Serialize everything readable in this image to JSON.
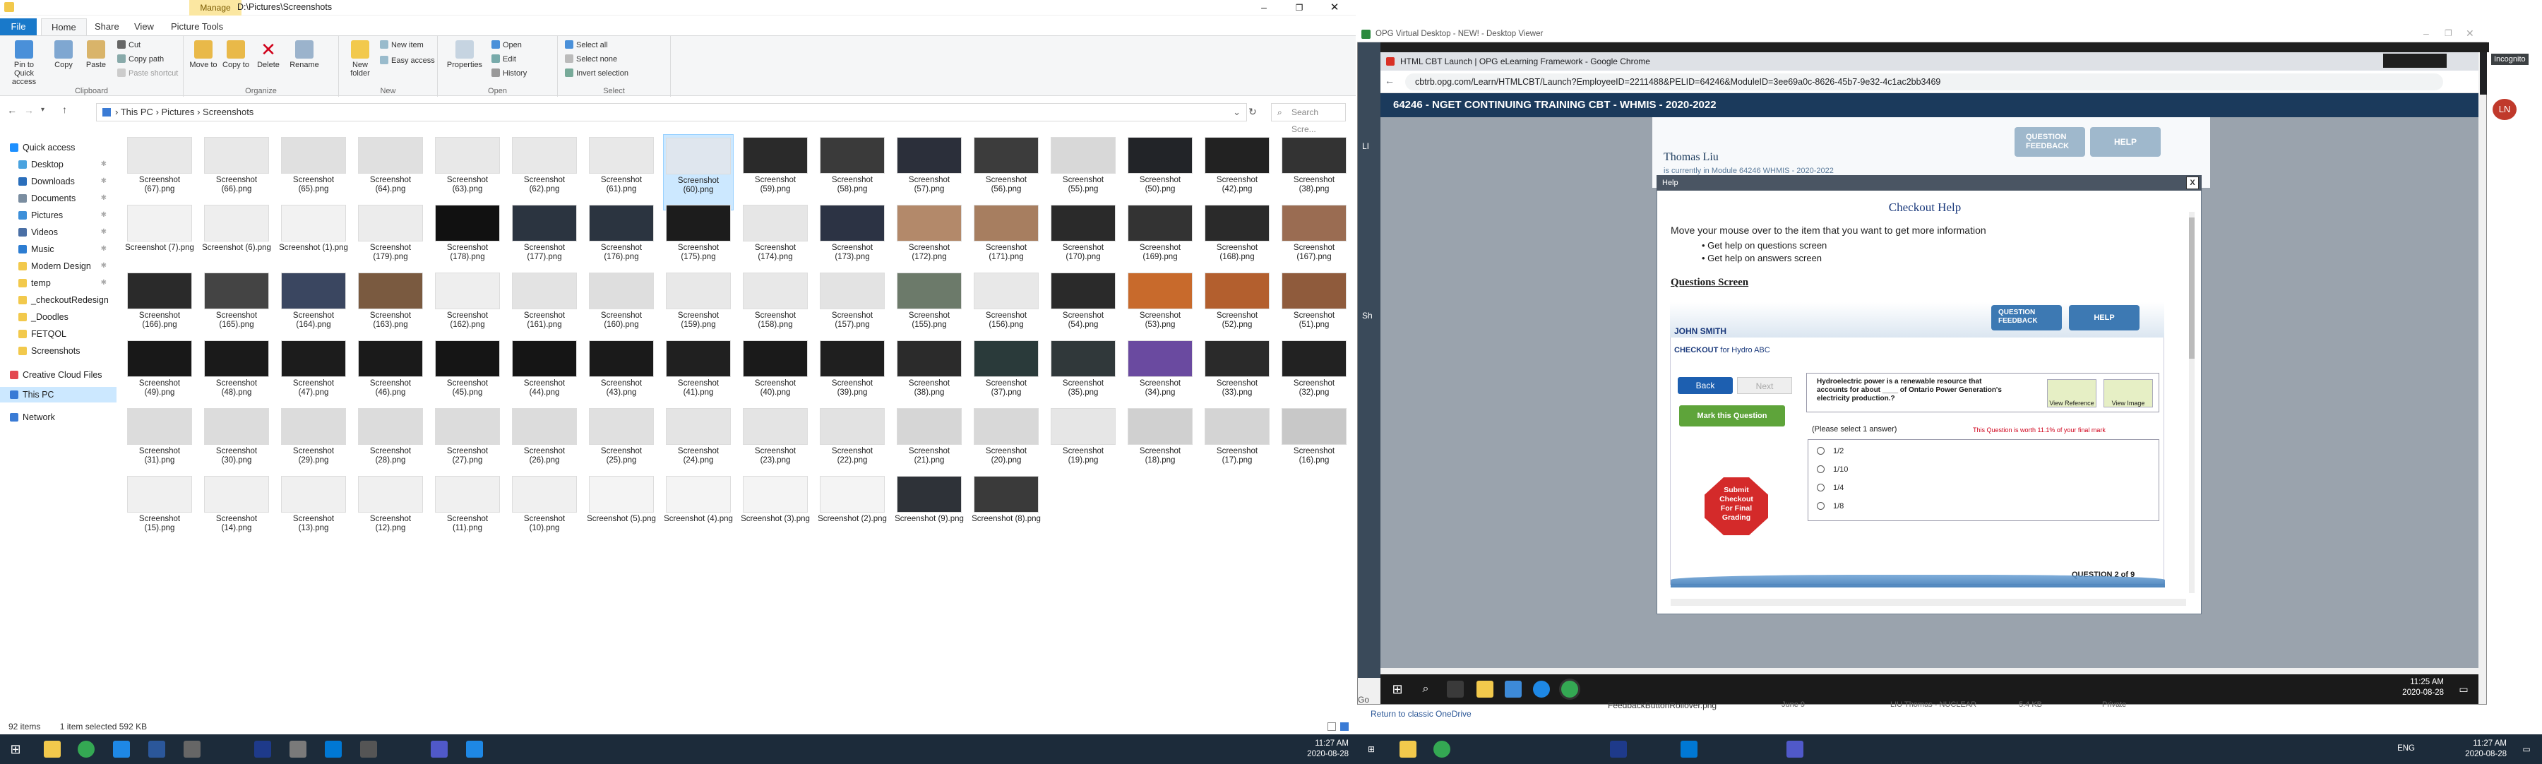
{
  "explorer": {
    "title": "D:\\Pictures\\Screenshots",
    "manage_tab": "Manage",
    "tabs": [
      "File",
      "Home",
      "Share",
      "View",
      "Picture Tools"
    ],
    "groups": {
      "clipboard": "Clipboard",
      "organize": "Organize",
      "new": "New",
      "open": "Open",
      "select": "Select"
    },
    "buttons": {
      "pin": "Pin to Quick access",
      "copy": "Copy",
      "paste": "Paste",
      "cut": "Cut",
      "copy_path": "Copy path",
      "paste_shortcut": "Paste shortcut",
      "move_to": "Move to",
      "copy_to": "Copy to",
      "delete": "Delete",
      "rename": "Rename",
      "new_folder": "New folder",
      "new_item": "New item",
      "easy_access": "Easy access",
      "properties": "Properties",
      "open": "Open",
      "edit": "Edit",
      "history": "History",
      "select_all": "Select all",
      "select_none": "Select none",
      "invert_selection": "Invert selection"
    },
    "breadcrumb": [
      "This PC",
      "Pictures",
      "Screenshots"
    ],
    "search_placeholder": "Search Scre...",
    "nav": [
      {
        "label": "Quick access",
        "icon": "star-icon",
        "color": "#1e90ff",
        "pin": false
      },
      {
        "label": "Desktop",
        "icon": "folder-icon",
        "color": "#4aa3df",
        "pin": true
      },
      {
        "label": "Downloads",
        "icon": "download-icon",
        "color": "#2a6ebb",
        "pin": true
      },
      {
        "label": "Documents",
        "icon": "documents-icon",
        "color": "#7a8da0",
        "pin": true
      },
      {
        "label": "Pictures",
        "icon": "pictures-icon",
        "color": "#3c8fd9",
        "pin": true
      },
      {
        "label": "Videos",
        "icon": "videos-icon",
        "color": "#4a6fa5",
        "pin": true
      },
      {
        "label": "Music",
        "icon": "music-icon",
        "color": "#2d7dd2",
        "pin": true
      },
      {
        "label": "Modern Design",
        "icon": "folder-icon",
        "color": "#f2c94c",
        "pin": true
      },
      {
        "label": "temp",
        "icon": "folder-icon",
        "color": "#f2c94c",
        "pin": true
      },
      {
        "label": "_checkoutRedesign",
        "icon": "folder-icon",
        "color": "#f2c94c",
        "pin": false
      },
      {
        "label": "_Doodles",
        "icon": "folder-icon",
        "color": "#f2c94c",
        "pin": false
      },
      {
        "label": "FETQOL",
        "icon": "folder-icon",
        "color": "#f2c94c",
        "pin": false
      },
      {
        "label": "Screenshots",
        "icon": "folder-icon",
        "color": "#f2c94c",
        "pin": false
      },
      {
        "label": "Creative Cloud Files",
        "icon": "cloud-icon",
        "color": "#e34850",
        "pin": false
      },
      {
        "label": "This PC",
        "icon": "computer-icon",
        "color": "#3a7bd5",
        "pin": false
      },
      {
        "label": "Network",
        "icon": "network-icon",
        "color": "#3a7bd5",
        "pin": false
      }
    ],
    "thumbs": [
      [
        "Screenshot (67).png",
        "Screenshot (66).png",
        "Screenshot (65).png",
        "Screenshot (64).png",
        "Screenshot (63).png",
        "Screenshot (62).png",
        "Screenshot (61).png",
        "Screenshot (60).png",
        "Screenshot (59).png",
        "Screenshot (58).png",
        "Screenshot (57).png",
        "Screenshot (56).png",
        "Screenshot (55).png",
        "Screenshot (50).png",
        "Screenshot (42).png",
        "Screenshot (38).png"
      ],
      [
        "Screenshot (7).png",
        "Screenshot (6).png",
        "Screenshot (1).png",
        "Screenshot (179).png",
        "Screenshot (178).png",
        "Screenshot (177).png",
        "Screenshot (176).png",
        "Screenshot (175).png",
        "Screenshot (174).png",
        "Screenshot (173).png",
        "Screenshot (172).png",
        "Screenshot (171).png",
        "Screenshot (170).png",
        "Screenshot (169).png",
        "Screenshot (168).png",
        "Screenshot (167).png"
      ],
      [
        "Screenshot (166).png",
        "Screenshot (165).png",
        "Screenshot (164).png",
        "Screenshot (163).png",
        "Screenshot (162).png",
        "Screenshot (161).png",
        "Screenshot (160).png",
        "Screenshot (159).png",
        "Screenshot (158).png",
        "Screenshot (157).png",
        "Screenshot (155).png",
        "Screenshot (156).png",
        "Screenshot (54).png",
        "Screenshot (53).png",
        "Screenshot (52).png",
        "Screenshot (51).png"
      ],
      [
        "Screenshot (49).png",
        "Screenshot (48).png",
        "Screenshot (47).png",
        "Screenshot (46).png",
        "Screenshot (45).png",
        "Screenshot (44).png",
        "Screenshot (43).png",
        "Screenshot (41).png",
        "Screenshot (40).png",
        "Screenshot (39).png",
        "Screenshot (38).png",
        "Screenshot (37).png",
        "Screenshot (35).png",
        "Screenshot (34).png",
        "Screenshot (33).png",
        "Screenshot (32).png"
      ],
      [
        "Screenshot (31).png",
        "Screenshot (30).png",
        "Screenshot (29).png",
        "Screenshot (28).png",
        "Screenshot (27).png",
        "Screenshot (26).png",
        "Screenshot (25).png",
        "Screenshot (24).png",
        "Screenshot (23).png",
        "Screenshot (22).png",
        "Screenshot (21).png",
        "Screenshot (20).png",
        "Screenshot (19).png",
        "Screenshot (18).png",
        "Screenshot (17).png",
        "Screenshot (16).png"
      ],
      [
        "Screenshot (15).png",
        "Screenshot (14).png",
        "Screenshot (13).png",
        "Screenshot (12).png",
        "Screenshot (11).png",
        "Screenshot (10).png",
        "Screenshot (5).png",
        "Screenshot (4).png",
        "Screenshot (3).png",
        "Screenshot (2).png",
        "Screenshot (9).png",
        "Screenshot (8).png"
      ]
    ],
    "thumb_tones": [
      [
        "#e8e8e8",
        "#e8e8e8",
        "#e0e0e0",
        "#e0e0e0",
        "#e8e8e8",
        "#e8e8e8",
        "#e8e8e8",
        "#dfe6ee",
        "#2a2a2a",
        "#3a3a3a",
        "#2b2f3a",
        "#3c3c3c",
        "#d8d8d8",
        "#222428",
        "#222",
        "#333"
      ],
      [
        "#f2f2f2",
        "#eeeeee",
        "#f2f2f2",
        "#ececec",
        "#111",
        "#2b3440",
        "#2b3440",
        "#1c1c1c",
        "#e6e6e6",
        "#2c3344",
        "#b3896a",
        "#a77e60",
        "#2a2a2a",
        "#333",
        "#2a2a2a",
        "#9a6c52"
      ],
      [
        "#2a2a2a",
        "#444",
        "#3a4660",
        "#7a5a40",
        "#eeeeee",
        "#e3e3e3",
        "#dedede",
        "#e8e8e8",
        "#e8e8e8",
        "#e3e3e3",
        "#6c7a6a",
        "#e8e8e8",
        "#2a2a2a",
        "#c86a2c",
        "#b35f2e",
        "#8f5b3c"
      ],
      [
        "#181818",
        "#1a1a1a",
        "#1c1c1c",
        "#1a1a1a",
        "#151515",
        "#151515",
        "#1a1a1a",
        "#202020",
        "#1a1a1a",
        "#1f1f1f",
        "#2b2b2b",
        "#2a3a3a",
        "#30383a",
        "#6a4aa0",
        "#2a2a2a",
        "#222"
      ],
      [
        "#dcdcdc",
        "#dcdcdc",
        "#dcdcdc",
        "#dcdcdc",
        "#dcdcdc",
        "#dcdcdc",
        "#e0e0e0",
        "#e4e4e4",
        "#e4e4e4",
        "#e2e2e2",
        "#d6d6d6",
        "#d8d8d8",
        "#e6e6e6",
        "#d0d0d0",
        "#d4d4d4",
        "#c8c8c8"
      ],
      [
        "#f0f0f0",
        "#f0f0f0",
        "#f0f0f0",
        "#f0f0f0",
        "#f0f0f0",
        "#f0f0f0",
        "#f4f4f4",
        "#f4f4f4",
        "#f4f4f4",
        "#f4f4f4",
        "#2e3238",
        "#3a3a3a"
      ]
    ],
    "selected_thumb": "Screenshot (60).png",
    "status": {
      "count": "92 items",
      "selection": "1 item selected  592 KB"
    }
  },
  "remote": {
    "viewer_title": "OPG Virtual Desktop - NEW! - Desktop Viewer",
    "chrome_title": "HTML CBT Launch | OPG eLearning Framework - Google Chrome",
    "incognito": "Incognito",
    "bookmarks": "bookmarks",
    "url": "cbtrb.opg.com/Learn/HTMLCBT/Launch?EmployeeID=2211488&PELID=64246&ModuleID=3ee69a0c-8626-45b7-9e32-4c1ac2bb3469",
    "course_title": "64246 - NGET CONTINUING TRAINING CBT - WHMIS - 2020-2022",
    "user": "Thomas Liu",
    "user_sub": "is currently in Module 64246 WHMIS - 2020-2022",
    "header_buttons": {
      "feedback": "QUESTION FEEDBACK",
      "help": "HELP"
    },
    "help": {
      "bar": "Help",
      "close": "X",
      "title": "Checkout Help",
      "intro": "Move your mouse over to the item that you want to get more information",
      "bullets": [
        "Get help on questions screen",
        "Get help on answers screen"
      ],
      "section": "Questions Screen",
      "preview": {
        "name": "JOHN SMITH",
        "checkout_prefix": "CHECKOUT",
        "checkout_for": "for Hydro ABC",
        "feedback": "QUESTION FEEDBACK",
        "help": "HELP",
        "back": "Back",
        "next": "Next",
        "mark": "Mark this Question",
        "submit": "Submit Checkout For Final Grading",
        "question": "Hydroelectric power is a renewable resource that accounts for about ____ of Ontario Power Generation's electricity production.?",
        "view_reference": "View Reference",
        "view_image": "View Image",
        "please_select": "(Please select 1 answer)",
        "worth": "This Question is worth 11.1% of your final mark",
        "options": [
          "1/2",
          "1/10",
          "1/4",
          "1/8"
        ],
        "qnum": "QUESTION 2 of 9"
      }
    },
    "left_letters": [
      "LI",
      "Sh"
    ],
    "taskbar_time": "11:25 AM",
    "taskbar_date": "2020-08-28",
    "return_onedrive": "Return to classic OneDrive",
    "file_row": {
      "name": "FeedbackButtonRollover.png",
      "col2": "June 9",
      "col3": "LIU Thomas - NUCLEAR",
      "col4": "5.4 KB",
      "col5": "Private"
    },
    "file_row_prefix": "Go"
  },
  "host_taskbar": {
    "left_time": "11:27 AM",
    "left_date": "2020-08-28",
    "right_time": "11:27 AM",
    "right_date": "2020-08-28",
    "lang": "ENG"
  }
}
